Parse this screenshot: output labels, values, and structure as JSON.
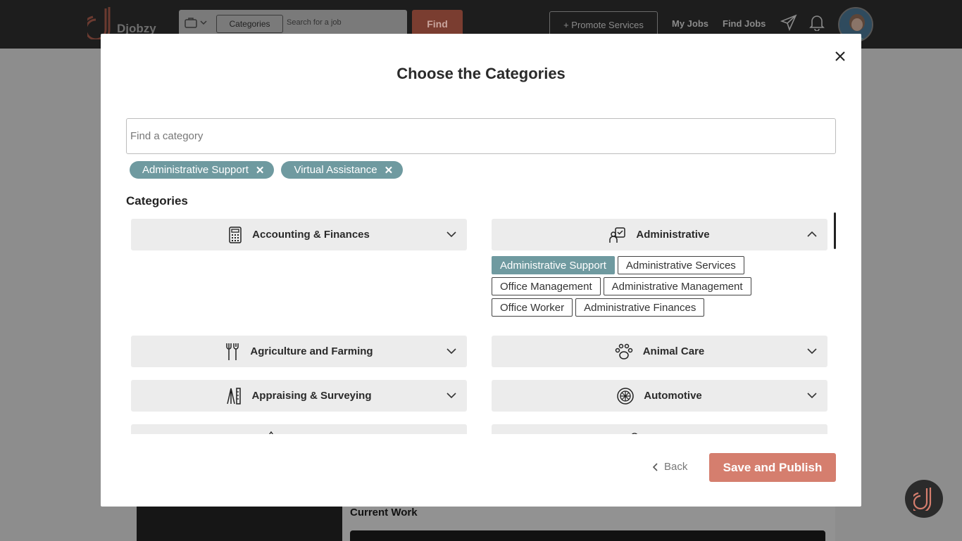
{
  "app": {
    "brand": "Djobzy",
    "search": {
      "categories_label": "Categories",
      "placeholder": "Search for a job",
      "find_label": "Find"
    },
    "nav": {
      "promote_label": "+ Promote Services",
      "my_jobs": "My Jobs",
      "find_jobs": "Find Jobs"
    },
    "background": {
      "current_work_label": "Current Work"
    }
  },
  "modal": {
    "title": "Choose the Categories",
    "find_placeholder": "Find a category",
    "selected_chips": [
      {
        "label": "Administrative Support"
      },
      {
        "label": "Virtual Assistance"
      }
    ],
    "section_label": "Categories",
    "categories": [
      {
        "label": "Accounting & Finances",
        "icon": "calculator-icon",
        "expanded": false
      },
      {
        "label": "Administrative",
        "icon": "admin-checklist-icon",
        "expanded": true
      },
      {
        "label": "Agriculture and Farming",
        "icon": "farming-tools-icon",
        "expanded": false
      },
      {
        "label": "Animal Care",
        "icon": "paw-icon",
        "expanded": false
      },
      {
        "label": "Appraising & Surveying",
        "icon": "surveying-icon",
        "expanded": false
      },
      {
        "label": "Automotive",
        "icon": "wheel-icon",
        "expanded": false
      }
    ],
    "administrative_subcategories": [
      {
        "label": "Administrative Support",
        "selected": true
      },
      {
        "label": "Administrative Services",
        "selected": false
      },
      {
        "label": "Office Management",
        "selected": false
      },
      {
        "label": "Administrative Management",
        "selected": false
      },
      {
        "label": "Office Worker",
        "selected": false
      },
      {
        "label": "Administrative Finances",
        "selected": false
      }
    ],
    "back_label": "Back",
    "save_label": "Save and Publish"
  },
  "colors": {
    "accent_teal": "#6f9aa0",
    "primary_salmon": "#d57e6e",
    "topbar": "#1d1d1d"
  }
}
